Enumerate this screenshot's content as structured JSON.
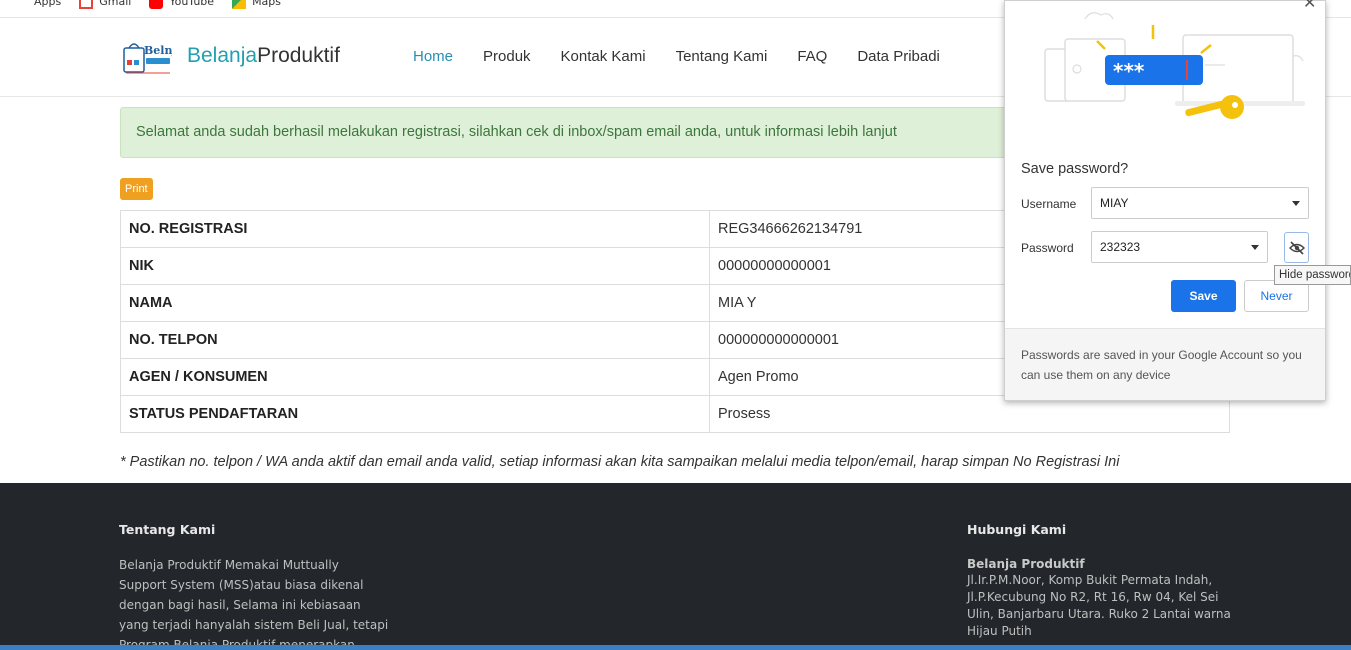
{
  "bookmarks": [
    {
      "label": "Apps",
      "icon": "apps-icon"
    },
    {
      "label": "Gmail",
      "icon": "gmail-icon"
    },
    {
      "label": "YouTube",
      "icon": "youtube-icon"
    },
    {
      "label": "Maps",
      "icon": "maps-icon"
    }
  ],
  "brand": {
    "part1": "Belanja",
    "part2": "Produktif",
    "logo_text": "Belnja"
  },
  "nav": [
    "Home",
    "Produk",
    "Kontak Kami",
    "Tentang Kami",
    "FAQ",
    "Data Pribadi"
  ],
  "alert": "Selamat anda sudah berhasil melakukan registrasi, silahkan cek di inbox/spam email anda, untuk informasi lebih lanjut",
  "print_label": "Print",
  "table": [
    {
      "key": "NO. REGISTRASI",
      "value": "REG34666262134791"
    },
    {
      "key": "NIK",
      "value": "00000000000001"
    },
    {
      "key": "NAMA",
      "value": "MIA Y"
    },
    {
      "key": "NO. TELPON",
      "value": "000000000000001"
    },
    {
      "key": "AGEN / KONSUMEN",
      "value": "Agen Promo"
    },
    {
      "key": "STATUS PENDAFTARAN",
      "value": "Prosess"
    }
  ],
  "note": "* Pastikan no. telpon / WA anda aktif dan email anda valid, setiap informasi akan kita sampaikan melalui media telpon/email, harap simpan No Registrasi Ini",
  "footer": {
    "about_title": "Tentang Kami",
    "about_text": "Belanja Produktif Memakai Muttually Support System (MSS)atau biasa dikenal dengan bagi hasil, Selama ini kebiasaan yang terjadi hanyalah sistem Beli Jual, tetapi Program Belanja Produktif menerapkan sistem Jual Beli",
    "contact_title": "Hubungi Kami",
    "contact_name": "Belanja Produktif",
    "contact_address": "Jl.Ir.P.M.Noor, Komp Bukit Permata Indah, Jl.P.Kecubung No R2, Rt 16, Rw 04, Kel Sei Ulin, Banjarbaru Utara. Ruko 2 Lantai warna Hijau Putih"
  },
  "password_popup": {
    "title": "Save password?",
    "username_label": "Username",
    "username_value": "MIAY",
    "password_label": "Password",
    "password_value": "232323",
    "illustration_text": "***",
    "tooltip": "Hide password",
    "save_label": "Save",
    "never_label": "Never",
    "footer_text": "Passwords are saved in your Google Account so you can use them on any device"
  },
  "colors": {
    "accent": "#1a73e8",
    "footer_bg": "#23272b",
    "alert_bg": "#dff0d8",
    "print_btn": "#f0a020"
  }
}
